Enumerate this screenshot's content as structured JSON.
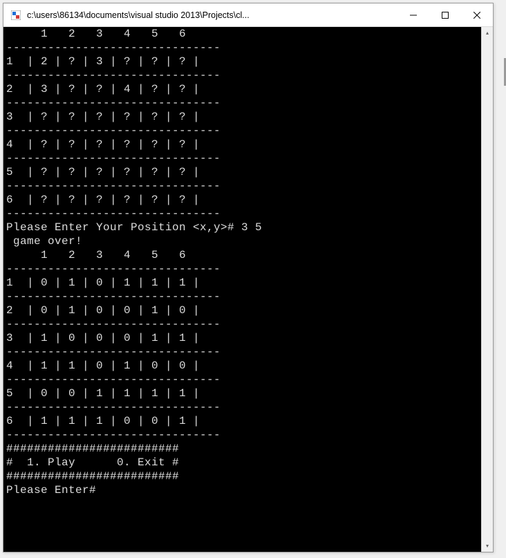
{
  "window": {
    "title": "c:\\users\\86134\\documents\\visual studio 2013\\Projects\\cl..."
  },
  "game": {
    "board1": {
      "headers": [
        "1",
        "2",
        "3",
        "4",
        "5",
        "6"
      ],
      "rows": [
        {
          "label": "1",
          "cells": [
            "2",
            "?",
            "3",
            "?",
            "?",
            "?"
          ]
        },
        {
          "label": "2",
          "cells": [
            "3",
            "?",
            "?",
            "4",
            "?",
            "?"
          ]
        },
        {
          "label": "3",
          "cells": [
            "?",
            "?",
            "?",
            "?",
            "?",
            "?"
          ]
        },
        {
          "label": "4",
          "cells": [
            "?",
            "?",
            "?",
            "?",
            "?",
            "?"
          ]
        },
        {
          "label": "5",
          "cells": [
            "?",
            "?",
            "?",
            "?",
            "?",
            "?"
          ]
        },
        {
          "label": "6",
          "cells": [
            "?",
            "?",
            "?",
            "?",
            "?",
            "?"
          ]
        }
      ]
    },
    "prompt1": "Please Enter Your Position <x,y># 3 5",
    "gameOver": " game over!",
    "board2": {
      "headers": [
        "1",
        "2",
        "3",
        "4",
        "5",
        "6"
      ],
      "rows": [
        {
          "label": "1",
          "cells": [
            "0",
            "1",
            "0",
            "1",
            "1",
            "1"
          ]
        },
        {
          "label": "2",
          "cells": [
            "0",
            "1",
            "0",
            "0",
            "1",
            "0"
          ]
        },
        {
          "label": "3",
          "cells": [
            "1",
            "0",
            "0",
            "0",
            "1",
            "1"
          ]
        },
        {
          "label": "4",
          "cells": [
            "1",
            "1",
            "0",
            "1",
            "0",
            "0"
          ]
        },
        {
          "label": "5",
          "cells": [
            "0",
            "0",
            "1",
            "1",
            "1",
            "1"
          ]
        },
        {
          "label": "6",
          "cells": [
            "1",
            "1",
            "1",
            "0",
            "0",
            "1"
          ]
        }
      ]
    },
    "menu": {
      "border": "#########################",
      "line": "#  1. Play      0. Exit #"
    },
    "prompt2": "Please Enter#"
  },
  "scrollbar": {
    "up_glyph": "▴",
    "down_glyph": "▾"
  }
}
